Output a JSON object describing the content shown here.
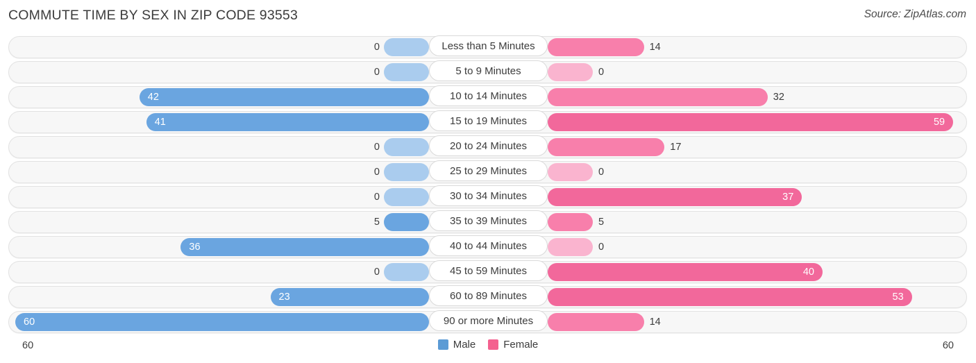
{
  "header": {
    "title": "COMMUTE TIME BY SEX IN ZIP CODE 93553",
    "source": "Source: ZipAtlas.com"
  },
  "legend": {
    "male_label": "Male",
    "female_label": "Female",
    "male_color": "#5b9bd5",
    "female_color": "#f4618f"
  },
  "axis": {
    "left_label": "60",
    "right_label": "60"
  },
  "chart_data": {
    "type": "bar",
    "title": "COMMUTE TIME BY SEX IN ZIP CODE 93553",
    "orientation": "horizontal-diverging",
    "xlabel": "",
    "ylabel": "",
    "xlim": [
      60,
      60
    ],
    "grid": false,
    "legend_position": "bottom-center",
    "categories": [
      "Less than 5 Minutes",
      "5 to 9 Minutes",
      "10 to 14 Minutes",
      "15 to 19 Minutes",
      "20 to 24 Minutes",
      "25 to 29 Minutes",
      "30 to 34 Minutes",
      "35 to 39 Minutes",
      "40 to 44 Minutes",
      "45 to 59 Minutes",
      "60 to 89 Minutes",
      "90 or more Minutes"
    ],
    "series": [
      {
        "name": "Male",
        "color": "#6aa5e0",
        "values": [
          0,
          0,
          42,
          41,
          0,
          0,
          0,
          5,
          36,
          0,
          23,
          60
        ]
      },
      {
        "name": "Female",
        "color": "#f2689b",
        "values": [
          14,
          0,
          32,
          59,
          17,
          0,
          37,
          5,
          0,
          40,
          53,
          14
        ]
      }
    ]
  },
  "rows": [
    {
      "category": "Less than 5 Minutes",
      "male": "0",
      "female": "14"
    },
    {
      "category": "5 to 9 Minutes",
      "male": "0",
      "female": "0"
    },
    {
      "category": "10 to 14 Minutes",
      "male": "42",
      "female": "32"
    },
    {
      "category": "15 to 19 Minutes",
      "male": "41",
      "female": "59"
    },
    {
      "category": "20 to 24 Minutes",
      "male": "0",
      "female": "17"
    },
    {
      "category": "25 to 29 Minutes",
      "male": "0",
      "female": "0"
    },
    {
      "category": "30 to 34 Minutes",
      "male": "0",
      "female": "37"
    },
    {
      "category": "35 to 39 Minutes",
      "male": "5",
      "female": "5"
    },
    {
      "category": "40 to 44 Minutes",
      "male": "36",
      "female": "0"
    },
    {
      "category": "45 to 59 Minutes",
      "male": "0",
      "female": "40"
    },
    {
      "category": "60 to 89 Minutes",
      "male": "23",
      "female": "53"
    },
    {
      "category": "90 or more Minutes",
      "male": "60",
      "female": "14"
    }
  ]
}
